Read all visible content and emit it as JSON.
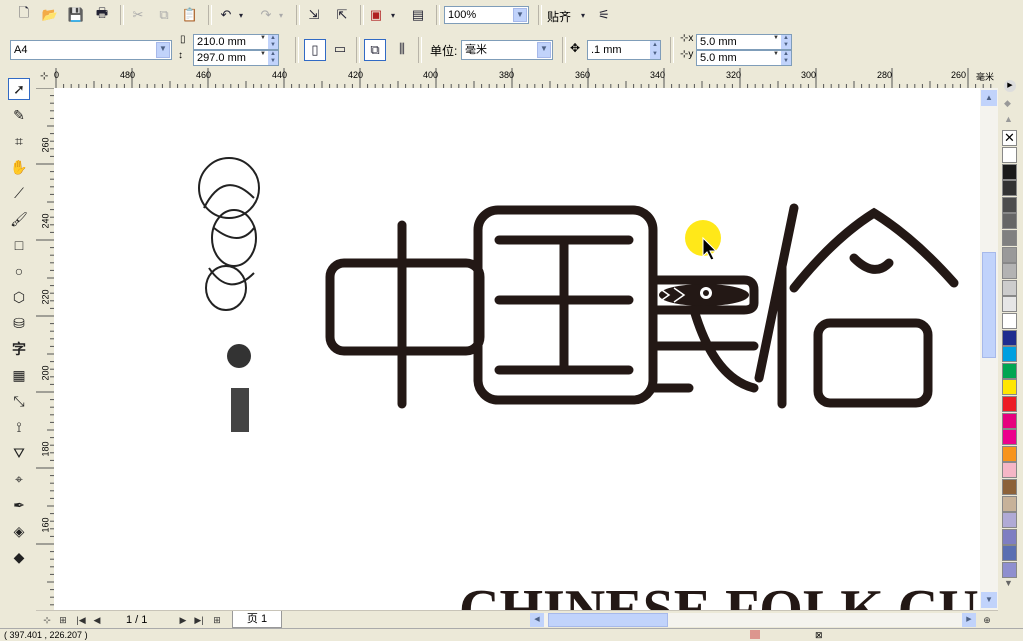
{
  "toolbar": {
    "zoom": "100%",
    "snap_label": "贴齐",
    "icons": [
      "new-icon",
      "open-icon",
      "save-icon",
      "print-icon",
      "cut-icon",
      "copy-icon",
      "paste-icon",
      "undo-icon",
      "redo-icon",
      "import-icon",
      "export-icon",
      "launcher-icon",
      "welcome-icon"
    ]
  },
  "propbar": {
    "paper_size": "A4",
    "width": "210.0 mm",
    "height": "297.0 mm",
    "units_label": "单位:",
    "units": "毫米",
    "nudge": ".1 mm",
    "dup_x": "5.0 mm",
    "dup_y": "5.0 mm"
  },
  "rulers": {
    "h_ticks": [
      "0",
      "480",
      "460",
      "440",
      "420",
      "400",
      "380",
      "360",
      "340",
      "320",
      "300",
      "280",
      "260"
    ],
    "h_unit": "毫米",
    "v_ticks": [
      "260",
      "240",
      "220",
      "200",
      "180",
      "160"
    ]
  },
  "toolbox": {
    "text_tool": "字"
  },
  "canvas": {
    "title_chars": [
      "中",
      "国",
      "民",
      "俗"
    ],
    "subtitle": "CHINESE FOLK CU"
  },
  "pages": {
    "counter": "1 / 1",
    "tab": "页 1"
  },
  "status": {
    "coords": "( 397.401 , 226.207 )"
  },
  "palette": [
    "#ffffff",
    "#1a1a1a",
    "#333333",
    "#4d4d4d",
    "#666666",
    "#808080",
    "#999999",
    "#b3b3b3",
    "#cccccc",
    "#e6e6e6",
    "#ffffff",
    "#1f2d8f",
    "#00a0e0",
    "#00a651",
    "#ffe600",
    "#ed1c24",
    "#e6007e",
    "#ec008c",
    "#f7941d",
    "#f5b6c6",
    "#8c6239",
    "#c7b299",
    "#b0aad6",
    "#7e7ec2",
    "#5a6fb2",
    "#8f8fcf"
  ]
}
